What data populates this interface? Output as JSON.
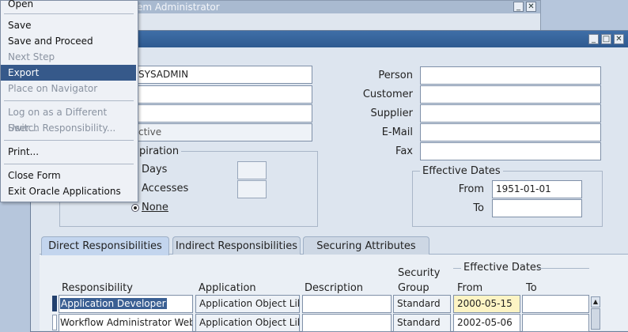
{
  "back_window": {
    "title": "em Administrator"
  },
  "main_window": {},
  "user": {
    "username": "SYSADMIN",
    "field2": "",
    "field3": "",
    "status": "ctive",
    "expiration_label": "piration",
    "days_label": "Days",
    "accesses_label": "Accesses",
    "none_label": "None"
  },
  "person": {
    "person_label": "Person",
    "customer_label": "Customer",
    "supplier_label": "Supplier",
    "email_label": "E-Mail",
    "fax_label": "Fax"
  },
  "effective_dates": {
    "title": "Effective Dates",
    "from_label": "From",
    "from_value": "1951-01-01",
    "to_label": "To",
    "to_value": ""
  },
  "tabs": [
    {
      "label": "Direct Responsibilities",
      "active": true
    },
    {
      "label": "Indirect Responsibilities",
      "active": false
    },
    {
      "label": "Securing Attributes",
      "active": false
    }
  ],
  "table": {
    "effective_dates_title": "Effective Dates",
    "headers": {
      "responsibility": "Responsibility",
      "application": "Application",
      "description": "Description",
      "security": "Security",
      "group": "Group",
      "from": "From",
      "to": "To"
    },
    "rows": [
      {
        "responsibility": "Application Developer",
        "application": "Application Object Lib",
        "description": "",
        "security_group": "Standard",
        "from": "2000-05-15",
        "to": ""
      },
      {
        "responsibility": "Workflow Administrator Web",
        "application": "Application Object Lib",
        "description": "",
        "security_group": "Standard",
        "from": "2002-05-06",
        "to": ""
      }
    ]
  },
  "menu": {
    "items": [
      {
        "label": "Open",
        "disabled": false
      },
      {
        "label": "Save",
        "disabled": false
      },
      {
        "label": "Save and Proceed",
        "disabled": false
      },
      {
        "label": "Next Step",
        "disabled": true
      },
      {
        "label": "Export",
        "disabled": false,
        "highlighted": true
      },
      {
        "label": "Place on Navigator",
        "disabled": true
      },
      {
        "label": "Log on as a Different User...",
        "disabled": true
      },
      {
        "label": "Switch Responsibility...",
        "disabled": true
      },
      {
        "label": "Print...",
        "disabled": false
      },
      {
        "label": "Close Form",
        "disabled": false
      },
      {
        "label": "Exit Oracle Applications",
        "disabled": false
      }
    ]
  },
  "colors": {
    "titlebar": "#2e5a90",
    "highlight": "#36598a",
    "date_highlight": "#fdf4c4"
  },
  "icons": {
    "minimize": "minimize-icon",
    "maximize": "maximize-icon",
    "close": "close-icon"
  }
}
